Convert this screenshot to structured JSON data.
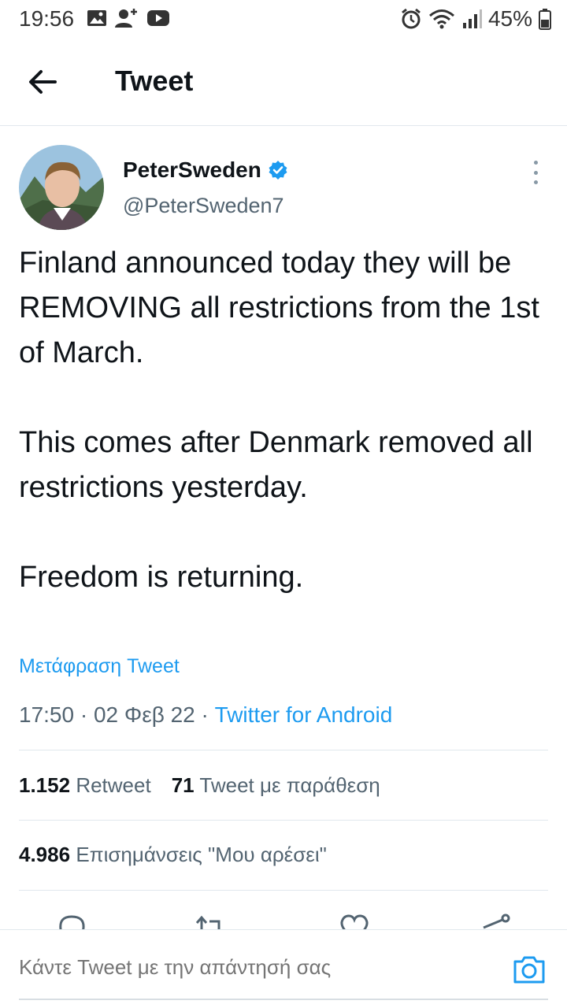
{
  "status_bar": {
    "time": "19:56",
    "battery": "45%"
  },
  "header": {
    "title": "Tweet"
  },
  "tweet": {
    "author_name": "PeterSweden",
    "author_handle": "@PeterSweden7",
    "text_paragraphs": [
      "Finland announced today they will be REMOVING all restrictions from the 1st of March.",
      "This comes after Denmark removed all restrictions yesterday.",
      "Freedom is returning."
    ],
    "translate": "Μετάφραση Tweet",
    "time": "17:50",
    "date": "02 Φεβ 22",
    "source": "Twitter for Android",
    "retweets_count": "1.152",
    "retweets_label": "Retweet",
    "quotes_count": "71",
    "quotes_label": "Tweet με παράθεση",
    "likes_count": "4.986",
    "likes_label": "Επισημάνσεις \"Μου αρέσει\""
  },
  "reply": {
    "placeholder": "Κάντε Tweet με την απάντησή σας"
  },
  "colors": {
    "accent": "#1d9bf0",
    "text": "#0f1419",
    "muted": "#536471"
  }
}
